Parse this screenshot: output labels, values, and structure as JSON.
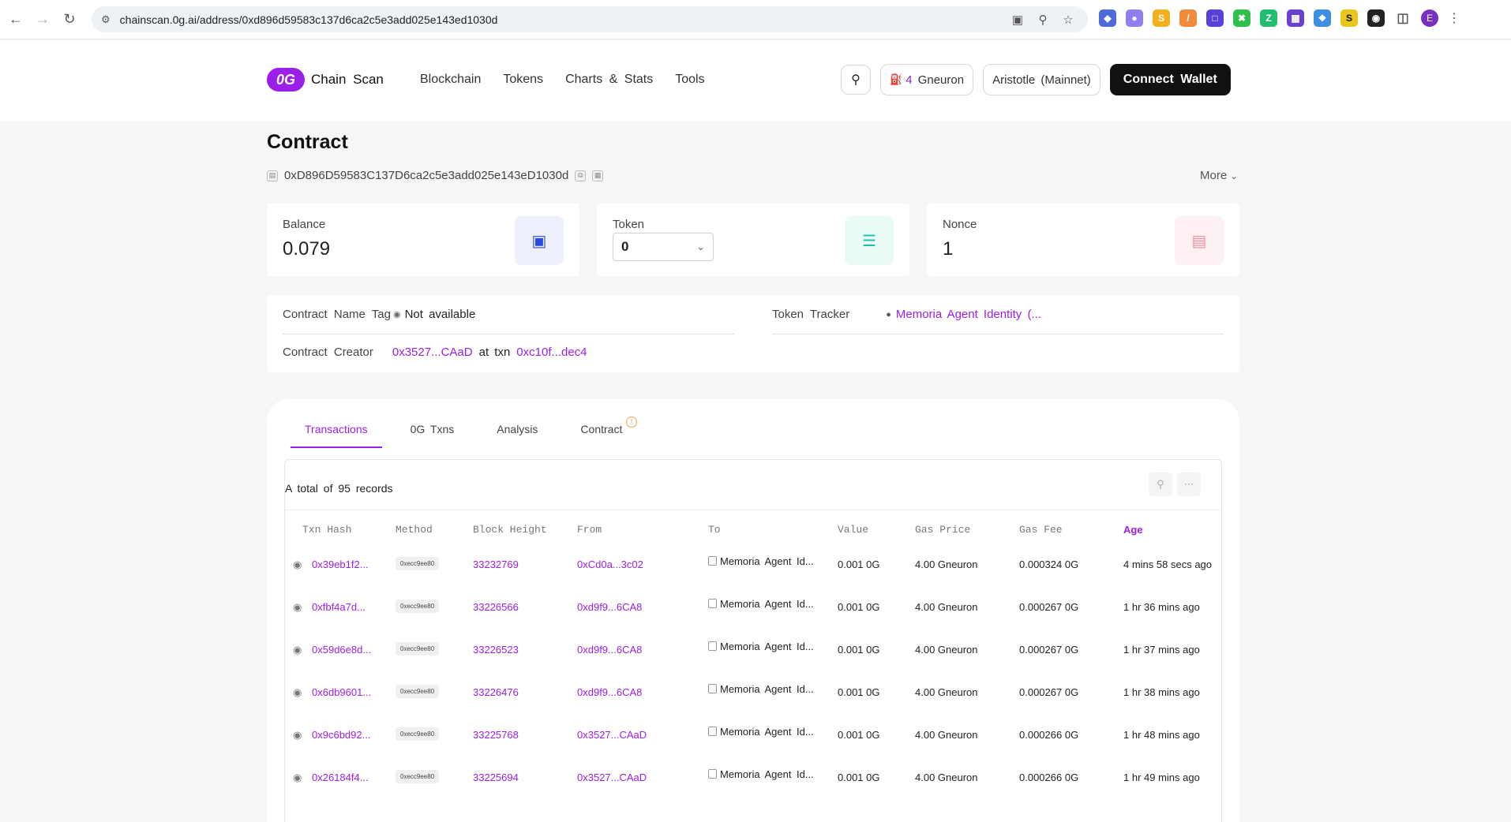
{
  "browser": {
    "url": "chainscan.0g.ai/address/0xd896d59583c137d6ca2c5e3add025e143ed1030d",
    "profile_initial": "E"
  },
  "header": {
    "logo_badge": "0G",
    "logo_text": "Chain Scan",
    "nav": [
      "Blockchain",
      "Tokens",
      "Charts & Stats",
      "Tools"
    ],
    "gas_value": "4",
    "gas_unit": " Gneuron",
    "network": "Aristotle (Mainnet)",
    "connect_label": "Connect Wallet"
  },
  "page": {
    "title": "Contract",
    "address": "0xD896D59583C137D6ca2c5e3add025e143eD1030d",
    "more_label": "More"
  },
  "cards": {
    "balance_label": "Balance",
    "balance_value": "0.079",
    "token_label": "Token",
    "token_value": "0",
    "nonce_label": "Nonce",
    "nonce_value": "1"
  },
  "info": {
    "name_tag_label": "Contract Name Tag",
    "name_tag_value": "Not available",
    "token_tracker_label": "Token Tracker",
    "token_tracker_value": "Memoria Agent Identity (...",
    "creator_label": "Contract Creator",
    "creator_address": "0x3527...CAaD",
    "at_txn": "at txn",
    "creator_txn": "0xc10f...dec4"
  },
  "tabs": [
    "Transactions",
    "0G Txns",
    "Analysis",
    "Contract"
  ],
  "table": {
    "records_text": "A total of 95 records",
    "columns": [
      "Txn Hash",
      "Method",
      "Block Height",
      "From",
      "To",
      "Value",
      "Gas Price",
      "Gas Fee",
      "Age"
    ],
    "rows": [
      {
        "hash": "0x39eb1f2...",
        "method": "0xecc9ee80",
        "block": "33232769",
        "from": "0xCd0a...3c02",
        "to": "Memoria Agent Id...",
        "value": "0.001 0G",
        "gas_price": "4.00 Gneuron",
        "gas_fee": "0.000324 0G",
        "age": "4 mins 58 secs ago"
      },
      {
        "hash": "0xfbf4a7d...",
        "method": "0xecc9ee80",
        "block": "33226566",
        "from": "0xd9f9...6CA8",
        "to": "Memoria Agent Id...",
        "value": "0.001 0G",
        "gas_price": "4.00 Gneuron",
        "gas_fee": "0.000267 0G",
        "age": "1 hr 36 mins ago"
      },
      {
        "hash": "0x59d6e8d...",
        "method": "0xecc9ee80",
        "block": "33226523",
        "from": "0xd9f9...6CA8",
        "to": "Memoria Agent Id...",
        "value": "0.001 0G",
        "gas_price": "4.00 Gneuron",
        "gas_fee": "0.000267 0G",
        "age": "1 hr 37 mins ago"
      },
      {
        "hash": "0x6db9601...",
        "method": "0xecc9ee80",
        "block": "33226476",
        "from": "0xd9f9...6CA8",
        "to": "Memoria Agent Id...",
        "value": "0.001 0G",
        "gas_price": "4.00 Gneuron",
        "gas_fee": "0.000267 0G",
        "age": "1 hr 38 mins ago"
      },
      {
        "hash": "0x9c6bd92...",
        "method": "0xecc9ee80",
        "block": "33225768",
        "from": "0x3527...CAaD",
        "to": "Memoria Agent Id...",
        "value": "0.001 0G",
        "gas_price": "4.00 Gneuron",
        "gas_fee": "0.000266 0G",
        "age": "1 hr 48 mins ago"
      },
      {
        "hash": "0x26184f4...",
        "method": "0xecc9ee80",
        "block": "33225694",
        "from": "0x3527...CAaD",
        "to": "Memoria Agent Id...",
        "value": "0.001 0G",
        "gas_price": "4.00 Gneuron",
        "gas_fee": "0.000266 0G",
        "age": "1 hr 49 mins ago"
      }
    ]
  }
}
